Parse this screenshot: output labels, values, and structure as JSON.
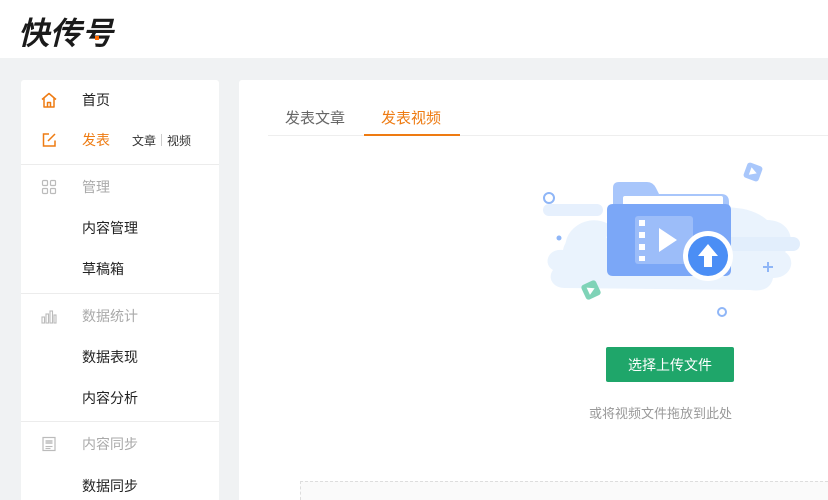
{
  "brand": {
    "name": "快传号"
  },
  "sidebar": {
    "home": {
      "label": "首页",
      "icon": "home-icon"
    },
    "publish": {
      "label": "发表",
      "icon": "edit-icon",
      "sub_article": "文章",
      "sub_video": "视频"
    },
    "manage": {
      "label": "管理",
      "icon": "grid-icon",
      "items": [
        {
          "label": "内容管理"
        },
        {
          "label": "草稿箱"
        }
      ]
    },
    "stats": {
      "label": "数据统计",
      "icon": "bar-chart-icon",
      "items": [
        {
          "label": "数据表现"
        },
        {
          "label": "内容分析"
        }
      ]
    },
    "sync": {
      "label": "内容同步",
      "icon": "document-icon",
      "items": [
        {
          "label": "数据同步"
        }
      ]
    }
  },
  "main": {
    "tabs": [
      {
        "label": "发表文章"
      },
      {
        "label": "发表视频"
      }
    ],
    "active_tab": "发表视频",
    "upload_button": "选择上传文件",
    "hint": "或将视频文件拖放到此处"
  },
  "colors": {
    "accent": "#ee7b12",
    "button": "#1fa66a",
    "illustration": "#7ba7f7"
  }
}
